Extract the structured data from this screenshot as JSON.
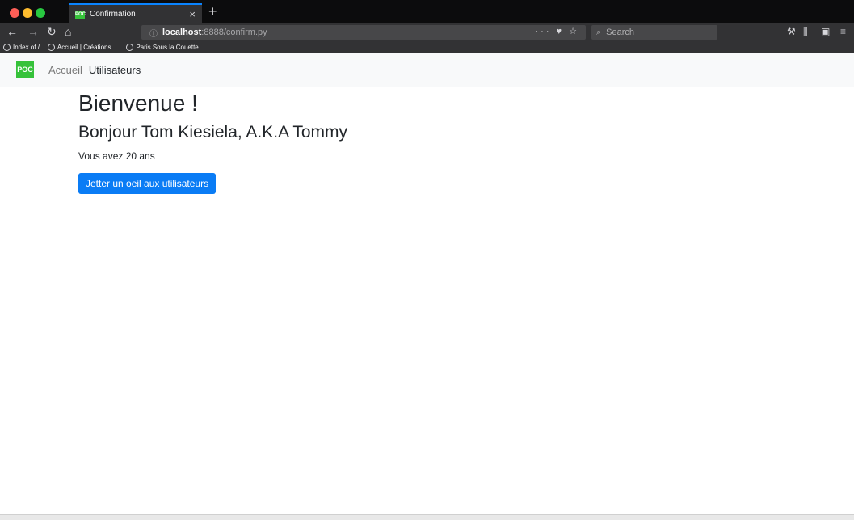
{
  "browser": {
    "tab": {
      "favicon_text": "POC",
      "title": "Confirmation",
      "close": "×"
    },
    "new_tab": "+",
    "url": {
      "info": "ⓘ",
      "host": "localhost",
      "path": ":8888/confirm.py",
      "actions": "··· ♥ ☆"
    },
    "search": {
      "placeholder": "Search"
    },
    "bookmarks": [
      {
        "label": "Index of /"
      },
      {
        "label": "Accueil | Créations ..."
      },
      {
        "label": "Paris Sous la Couette"
      }
    ]
  },
  "navbar": {
    "brand": "POC",
    "links": [
      {
        "label": "Accueil"
      },
      {
        "label": "Utilisateurs"
      }
    ]
  },
  "main": {
    "title": "Bienvenue !",
    "greeting": "Bonjour Tom Kiesiela, A.K.A Tommy",
    "age_text": "Vous avez 20 ans",
    "button_label": "Jetter un oeil aux utilisateurs"
  },
  "colors": {
    "brand": "#36c23a",
    "primary_button": "#0a7cf5",
    "navbar_bg": "#f8f9fa"
  }
}
